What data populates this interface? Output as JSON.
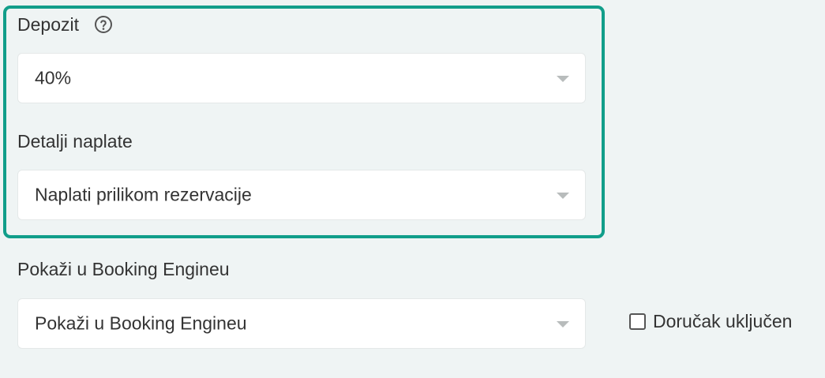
{
  "deposit": {
    "label": "Depozit",
    "help_icon": "question-circle-icon",
    "value": "40%"
  },
  "payment_details": {
    "label": "Detalji naplate",
    "value": "Naplati prilikom rezervacije"
  },
  "booking_engine": {
    "label": "Pokaži u Booking Engineu",
    "value": "Pokaži u Booking Engineu"
  },
  "breakfast": {
    "label": "Doručak uključen",
    "checked": false
  },
  "colors": {
    "highlight_border": "#119e8a",
    "background": "#eff4f4",
    "field_background": "#ffffff"
  }
}
